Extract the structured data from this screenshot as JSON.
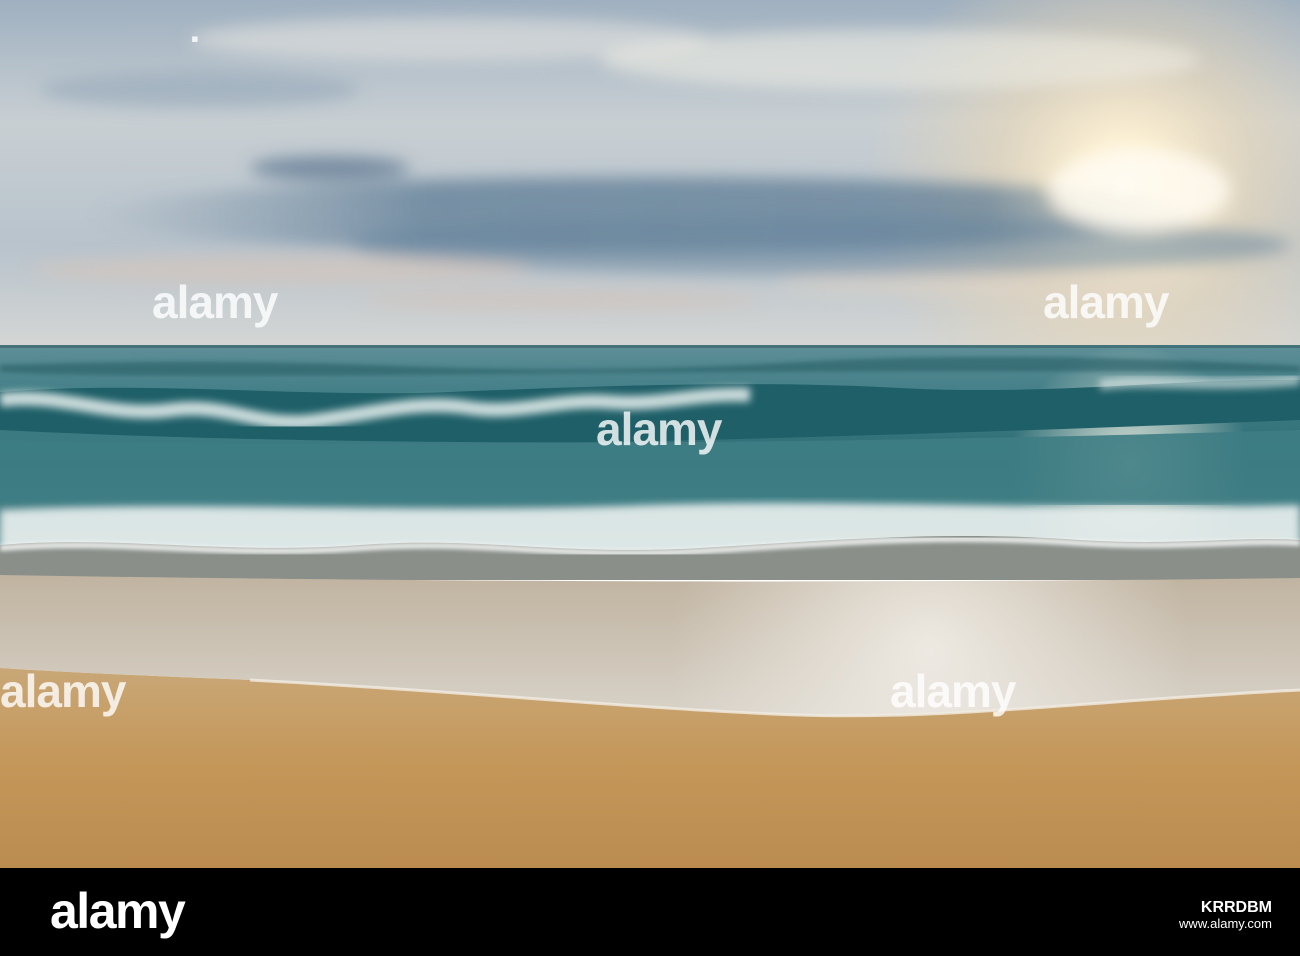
{
  "watermark": {
    "text": "alamy"
  },
  "footer": {
    "logo": "alamy",
    "image_id": "KRRDBM",
    "site": "www.alamy.com",
    "background_color": "#000000"
  },
  "palette": {
    "sky_top": "#9fb3c3",
    "sun_glow": "#fff9e6",
    "sea_deep": "#2e6f77",
    "sand": "#c49658"
  }
}
